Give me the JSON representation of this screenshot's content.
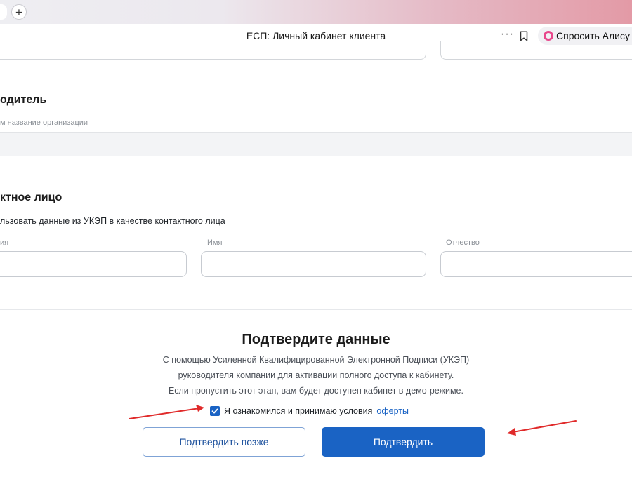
{
  "browser": {
    "new_tab_symbol": "+",
    "page_title": "ЕСП: Личный кабинет клиента",
    "more_symbol": "···",
    "alice_label": "Спросить Алису д"
  },
  "form": {
    "head": {
      "heading": "одитель",
      "org_label": "м название организации"
    },
    "contact": {
      "heading": "ктное лицо",
      "use_ukep_text": "льзовать данные из УКЭП в качестве контактного лица",
      "fields": [
        {
          "label": "ия",
          "value": ""
        },
        {
          "label": "Имя",
          "value": ""
        },
        {
          "label": "Отчество",
          "value": ""
        }
      ]
    }
  },
  "confirm": {
    "title": "Подтвердите данные",
    "lines": [
      "С помощью Усиленной Квалифицированной Электронной Подписи (УКЭП)",
      "руководителя компании для активации полного доступа к кабинету.",
      "Если пропустить этот этап, вам будет доступен кабинет в демо-режиме."
    ],
    "agree_text": "Я ознакомился и принимаю условия",
    "offer_link": "оферты",
    "checkbox_checked": true,
    "later_button": "Подтвердить позже",
    "confirm_button": "Подтвердить"
  },
  "colors": {
    "primary": "#1a63c4",
    "annotation_arrow": "#e02a2a"
  }
}
